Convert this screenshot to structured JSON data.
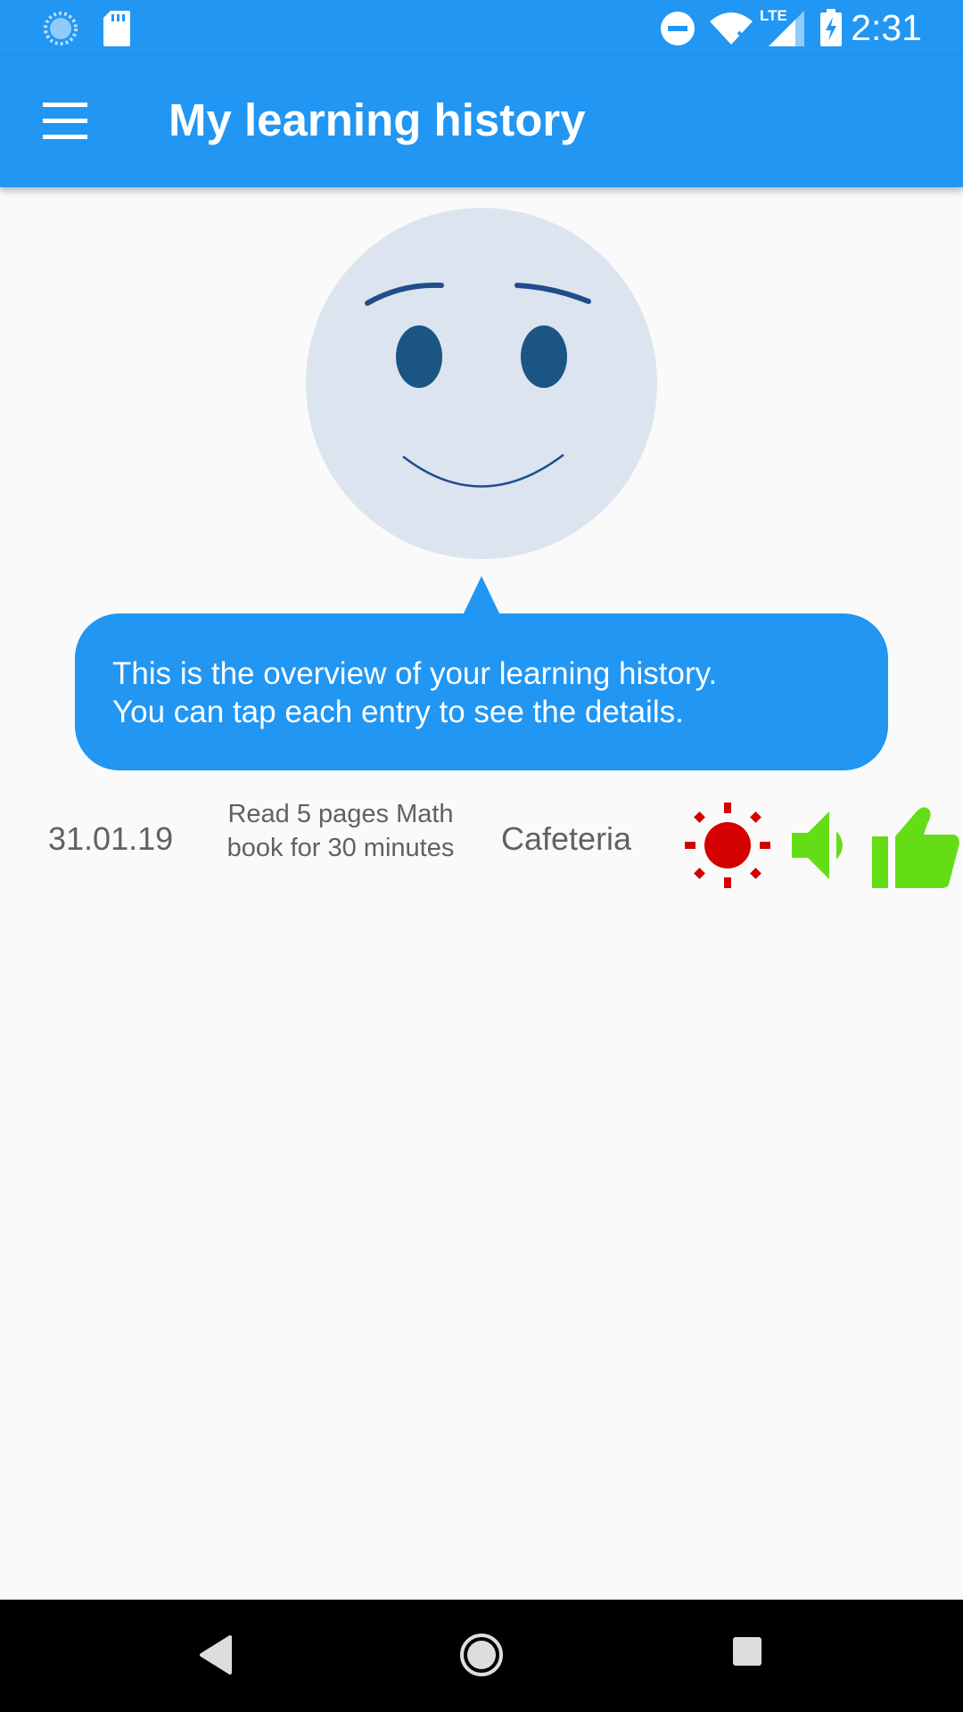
{
  "status_bar": {
    "time": "2:31",
    "network_label": "LTE",
    "left_icons": [
      "sync-icon",
      "sd-card-icon"
    ],
    "right_icons": [
      "do-not-disturb-icon",
      "wifi-icon",
      "signal-icon",
      "battery-charging-icon"
    ]
  },
  "app_bar": {
    "title": "My learning history",
    "menu_icon": "hamburger-menu-icon"
  },
  "mascot": {
    "description_icon": "smiley-face-icon"
  },
  "tooltip": {
    "line1": "This is the overview of your learning history.",
    "line2": "You can tap each entry to see the details."
  },
  "entries": [
    {
      "date": "31.01.19",
      "description": "Read 5 pages Math book for 30 minutes",
      "location": "Cafeteria",
      "icons": [
        "sun-icon",
        "speaker-icon",
        "thumbs-up-icon"
      ]
    }
  ],
  "colors": {
    "primary": "#2196F3",
    "sun": "#D50000",
    "positive": "#64DD17",
    "face": "#DCE4EF",
    "face_features": "#1A5584"
  },
  "nav_bar": {
    "buttons": [
      "back-icon",
      "home-icon",
      "recent-apps-icon"
    ]
  }
}
